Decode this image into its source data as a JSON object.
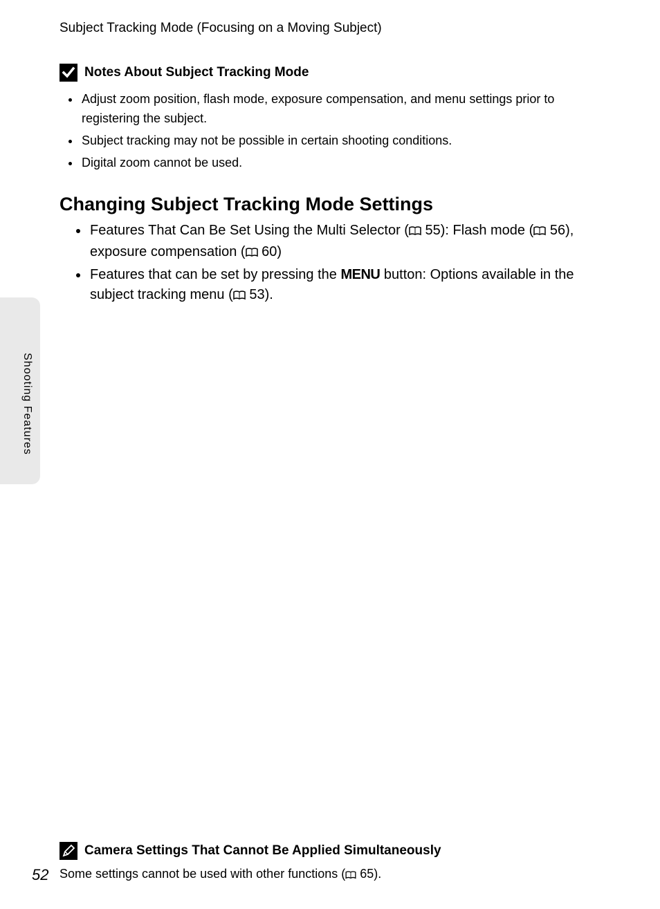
{
  "header": {
    "title": "Subject Tracking Mode (Focusing on a Moving Subject)"
  },
  "notes_section": {
    "title": "Notes About Subject Tracking Mode",
    "items": [
      "Adjust zoom position, flash mode, exposure compensation, and menu settings prior to registering the subject.",
      "Subject tracking may not be possible in certain shooting conditions.",
      "Digital zoom cannot be used."
    ]
  },
  "changing_section": {
    "heading": "Changing Subject Tracking Mode Settings",
    "item1": {
      "pre": "Features That Can Be Set Using the Multi Selector (",
      "ref1": " 55): Flash mode (",
      "ref2": " 56), exposure compensation (",
      "ref3": " 60)"
    },
    "item2": {
      "pre": "Features that can be set by pressing the ",
      "menu": "MENU",
      "mid": " button: Options available in the subject tracking menu (",
      "ref": " 53)."
    }
  },
  "side": {
    "label": "Shooting Features"
  },
  "footer": {
    "title": "Camera Settings That Cannot Be Applied Simultaneously",
    "text_pre": "Some settings cannot be used with other functions (",
    "text_post": " 65)."
  },
  "page_number": "52"
}
